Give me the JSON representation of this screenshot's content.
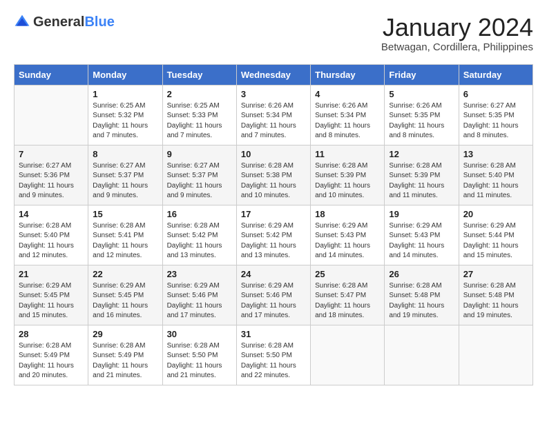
{
  "header": {
    "logo_general": "General",
    "logo_blue": "Blue",
    "month_year": "January 2024",
    "location": "Betwagan, Cordillera, Philippines"
  },
  "days_of_week": [
    "Sunday",
    "Monday",
    "Tuesday",
    "Wednesday",
    "Thursday",
    "Friday",
    "Saturday"
  ],
  "weeks": [
    [
      {
        "num": "",
        "info": ""
      },
      {
        "num": "1",
        "info": "Sunrise: 6:25 AM\nSunset: 5:32 PM\nDaylight: 11 hours\nand 7 minutes."
      },
      {
        "num": "2",
        "info": "Sunrise: 6:25 AM\nSunset: 5:33 PM\nDaylight: 11 hours\nand 7 minutes."
      },
      {
        "num": "3",
        "info": "Sunrise: 6:26 AM\nSunset: 5:34 PM\nDaylight: 11 hours\nand 7 minutes."
      },
      {
        "num": "4",
        "info": "Sunrise: 6:26 AM\nSunset: 5:34 PM\nDaylight: 11 hours\nand 8 minutes."
      },
      {
        "num": "5",
        "info": "Sunrise: 6:26 AM\nSunset: 5:35 PM\nDaylight: 11 hours\nand 8 minutes."
      },
      {
        "num": "6",
        "info": "Sunrise: 6:27 AM\nSunset: 5:35 PM\nDaylight: 11 hours\nand 8 minutes."
      }
    ],
    [
      {
        "num": "7",
        "info": "Sunrise: 6:27 AM\nSunset: 5:36 PM\nDaylight: 11 hours\nand 9 minutes."
      },
      {
        "num": "8",
        "info": "Sunrise: 6:27 AM\nSunset: 5:37 PM\nDaylight: 11 hours\nand 9 minutes."
      },
      {
        "num": "9",
        "info": "Sunrise: 6:27 AM\nSunset: 5:37 PM\nDaylight: 11 hours\nand 9 minutes."
      },
      {
        "num": "10",
        "info": "Sunrise: 6:28 AM\nSunset: 5:38 PM\nDaylight: 11 hours\nand 10 minutes."
      },
      {
        "num": "11",
        "info": "Sunrise: 6:28 AM\nSunset: 5:39 PM\nDaylight: 11 hours\nand 10 minutes."
      },
      {
        "num": "12",
        "info": "Sunrise: 6:28 AM\nSunset: 5:39 PM\nDaylight: 11 hours\nand 11 minutes."
      },
      {
        "num": "13",
        "info": "Sunrise: 6:28 AM\nSunset: 5:40 PM\nDaylight: 11 hours\nand 11 minutes."
      }
    ],
    [
      {
        "num": "14",
        "info": "Sunrise: 6:28 AM\nSunset: 5:40 PM\nDaylight: 11 hours\nand 12 minutes."
      },
      {
        "num": "15",
        "info": "Sunrise: 6:28 AM\nSunset: 5:41 PM\nDaylight: 11 hours\nand 12 minutes."
      },
      {
        "num": "16",
        "info": "Sunrise: 6:28 AM\nSunset: 5:42 PM\nDaylight: 11 hours\nand 13 minutes."
      },
      {
        "num": "17",
        "info": "Sunrise: 6:29 AM\nSunset: 5:42 PM\nDaylight: 11 hours\nand 13 minutes."
      },
      {
        "num": "18",
        "info": "Sunrise: 6:29 AM\nSunset: 5:43 PM\nDaylight: 11 hours\nand 14 minutes."
      },
      {
        "num": "19",
        "info": "Sunrise: 6:29 AM\nSunset: 5:43 PM\nDaylight: 11 hours\nand 14 minutes."
      },
      {
        "num": "20",
        "info": "Sunrise: 6:29 AM\nSunset: 5:44 PM\nDaylight: 11 hours\nand 15 minutes."
      }
    ],
    [
      {
        "num": "21",
        "info": "Sunrise: 6:29 AM\nSunset: 5:45 PM\nDaylight: 11 hours\nand 15 minutes."
      },
      {
        "num": "22",
        "info": "Sunrise: 6:29 AM\nSunset: 5:45 PM\nDaylight: 11 hours\nand 16 minutes."
      },
      {
        "num": "23",
        "info": "Sunrise: 6:29 AM\nSunset: 5:46 PM\nDaylight: 11 hours\nand 17 minutes."
      },
      {
        "num": "24",
        "info": "Sunrise: 6:29 AM\nSunset: 5:46 PM\nDaylight: 11 hours\nand 17 minutes."
      },
      {
        "num": "25",
        "info": "Sunrise: 6:28 AM\nSunset: 5:47 PM\nDaylight: 11 hours\nand 18 minutes."
      },
      {
        "num": "26",
        "info": "Sunrise: 6:28 AM\nSunset: 5:48 PM\nDaylight: 11 hours\nand 19 minutes."
      },
      {
        "num": "27",
        "info": "Sunrise: 6:28 AM\nSunset: 5:48 PM\nDaylight: 11 hours\nand 19 minutes."
      }
    ],
    [
      {
        "num": "28",
        "info": "Sunrise: 6:28 AM\nSunset: 5:49 PM\nDaylight: 11 hours\nand 20 minutes."
      },
      {
        "num": "29",
        "info": "Sunrise: 6:28 AM\nSunset: 5:49 PM\nDaylight: 11 hours\nand 21 minutes."
      },
      {
        "num": "30",
        "info": "Sunrise: 6:28 AM\nSunset: 5:50 PM\nDaylight: 11 hours\nand 21 minutes."
      },
      {
        "num": "31",
        "info": "Sunrise: 6:28 AM\nSunset: 5:50 PM\nDaylight: 11 hours\nand 22 minutes."
      },
      {
        "num": "",
        "info": ""
      },
      {
        "num": "",
        "info": ""
      },
      {
        "num": "",
        "info": ""
      }
    ]
  ]
}
